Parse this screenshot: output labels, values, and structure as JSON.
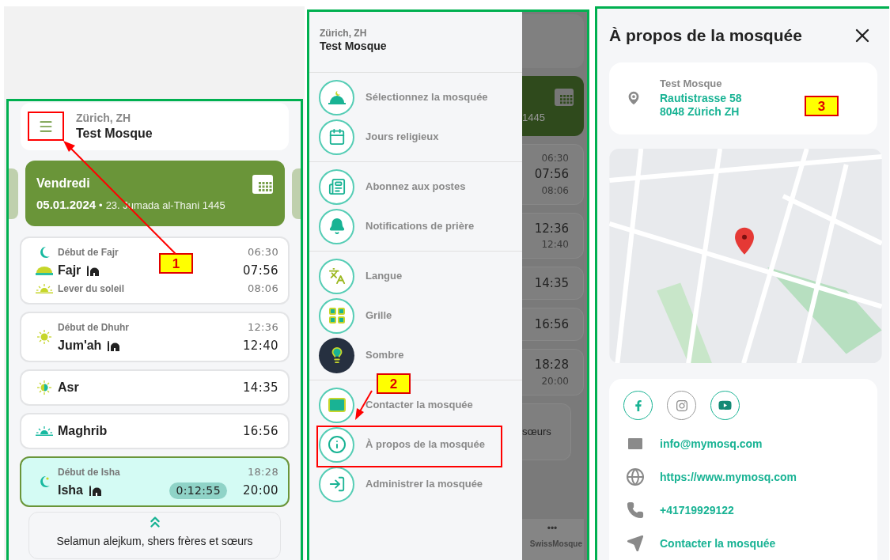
{
  "home": {
    "location": "Zürich, ZH",
    "mosque": "Test Mosque",
    "date_card": {
      "weekday": "Vendredi",
      "date": "05.01.2024",
      "separator": "•",
      "hijri": "23. Jumada al-Thani 1445"
    },
    "prayers": [
      {
        "start": {
          "label": "Début de Fajr",
          "time": "06:30"
        },
        "name": "Fajr",
        "jamaat": true,
        "time": "07:56",
        "after": {
          "label": "Lever du soleil",
          "time": "08:06"
        },
        "selected": false
      },
      {
        "start": {
          "label": "Début de Dhuhr",
          "time": "12:36"
        },
        "name": "Jum'ah",
        "jamaat": true,
        "time": "12:40",
        "selected": false
      },
      {
        "name": "Asr",
        "jamaat": false,
        "time": "14:35",
        "selected": false
      },
      {
        "name": "Maghrib",
        "jamaat": false,
        "time": "16:56",
        "selected": false
      },
      {
        "start": {
          "label": "Début de Isha",
          "time": "18:28"
        },
        "name": "Isha",
        "jamaat": true,
        "time": "20:00",
        "countdown": "0:12:55",
        "selected": true
      }
    ],
    "greeting": "Selamun alejkum, shers frères et sœurs"
  },
  "drawer": {
    "location": "Zürich, ZH",
    "mosque": "Test Mosque",
    "groups": [
      [
        {
          "label": "Sélectionnez la mosquée"
        },
        {
          "label": "Jours religieux"
        }
      ],
      [
        {
          "label": "Abonnez aux postes"
        },
        {
          "label": "Notifications de prière"
        }
      ],
      [
        {
          "label": "Langue"
        },
        {
          "label": "Grille"
        },
        {
          "label": "Sombre"
        }
      ],
      [
        {
          "label": "Contacter la mosquée"
        },
        {
          "label": "À propos de la mosquée"
        },
        {
          "label": "Administrer la mosquée"
        }
      ]
    ]
  },
  "behind_drawer": {
    "year": "1445",
    "cards": [
      [
        "06:30",
        "07:56",
        "08:06"
      ],
      [
        "12:36",
        "12:40"
      ],
      [
        "14:35"
      ],
      [
        "16:56"
      ],
      [
        "18:28",
        "20:00"
      ]
    ],
    "greeting_end": "sœurs",
    "nav_more": "•••",
    "nav_label": "SwissMosque"
  },
  "about": {
    "title": "À propos de la mosquée",
    "address": {
      "name": "Test Mosque",
      "street": "Rautistrasse 58",
      "city": "8048 Zürich ZH"
    },
    "contacts": [
      {
        "kind": "email",
        "text": "info@mymosq.com"
      },
      {
        "kind": "web",
        "text": "https://www.mymosq.com"
      },
      {
        "kind": "phone",
        "text": "+41719929122"
      },
      {
        "kind": "contact",
        "text": "Contacter la mosquée"
      }
    ]
  },
  "annotations": [
    {
      "label": "1"
    },
    {
      "label": "2"
    },
    {
      "label": "3"
    }
  ]
}
